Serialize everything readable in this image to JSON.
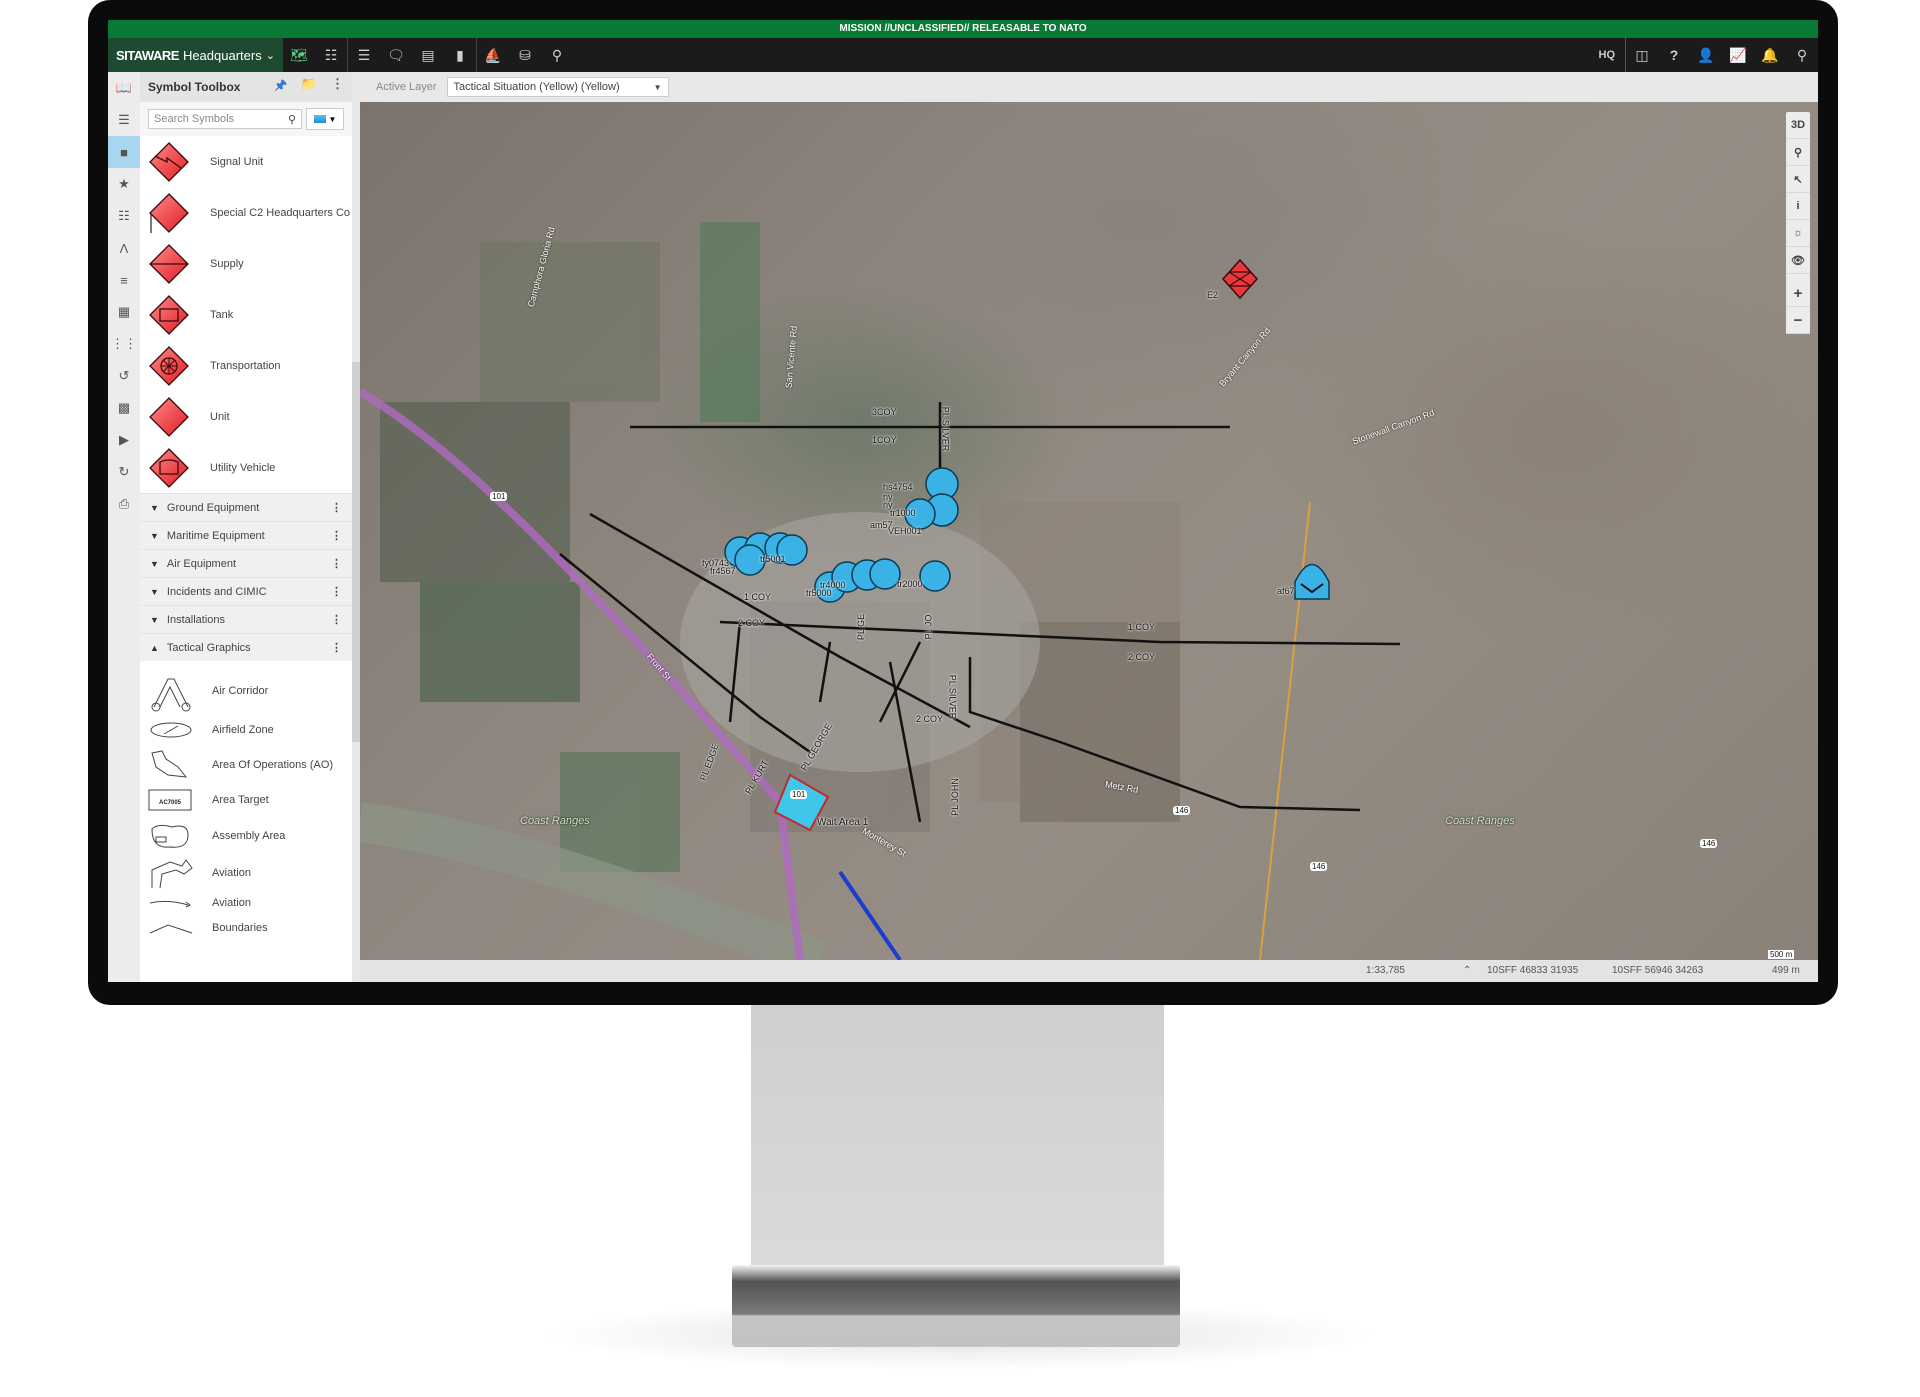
{
  "classification_banner": "MISSION //UNCLASSIFIED// RELEASABLE TO NATO",
  "app": {
    "brand_bold": "SITAWARE",
    "brand_rest": "Headquarters",
    "toolbar_left_icons": [
      "map-icon",
      "hierarchy-icon",
      "layers-list-icon",
      "chat-icon",
      "document-icon",
      "notebook-icon",
      "ship-icon",
      "database-search-icon",
      "search-icon"
    ],
    "hq_label": "HQ",
    "toolbar_right_icons": [
      "split-view-icon",
      "help-icon",
      "user-icon",
      "presentation-icon",
      "bell-icon",
      "search-icon"
    ],
    "colors": {
      "classification_green": "#087a35",
      "brand_bg": "#1e4a30",
      "toolbar_bg": "#1b1b1b",
      "hostile_red": "#e8383d",
      "friendly_blue": "#3ab2e6",
      "bell_yellow": "#e0a800"
    }
  },
  "left_rail": [
    "map-book-icon",
    "layers-icon",
    "symbols-icon",
    "favorites-icon",
    "org-chart-icon",
    "navigation-icon",
    "stack-icon",
    "forms-icon",
    "footsteps-icon",
    "history-icon",
    "film-icon",
    "video-icon",
    "replay-icon",
    "print-icon"
  ],
  "symbol_toolbox": {
    "title": "Symbol Toolbox",
    "search_placeholder": "Search Symbols",
    "units": [
      {
        "label": "Signal Unit",
        "icon": "signal-unit-icon"
      },
      {
        "label": "Special C2 Headquarters Co",
        "icon": "special-c2-hq-icon"
      },
      {
        "label": "Supply",
        "icon": "supply-icon"
      },
      {
        "label": "Tank",
        "icon": "tank-icon"
      },
      {
        "label": "Transportation",
        "icon": "transportation-icon"
      },
      {
        "label": "Unit",
        "icon": "unit-icon"
      },
      {
        "label": "Utility Vehicle",
        "icon": "utility-vehicle-icon"
      }
    ],
    "categories": [
      {
        "label": "Ground Equipment",
        "expanded": false
      },
      {
        "label": "Maritime Equipment",
        "expanded": false
      },
      {
        "label": "Air Equipment",
        "expanded": false
      },
      {
        "label": "Incidents and CIMIC",
        "expanded": false
      },
      {
        "label": "Installations",
        "expanded": false
      },
      {
        "label": "Tactical Graphics",
        "expanded": true
      }
    ],
    "tactical_graphics": [
      {
        "label": "Air Corridor",
        "icon": "air-corridor-icon"
      },
      {
        "label": "Airfield Zone",
        "icon": "airfield-zone-icon"
      },
      {
        "label": "Area Of Operations (AO)",
        "icon": "area-of-operations-icon"
      },
      {
        "label": "Area Target",
        "icon": "area-target-icon",
        "icon_text": "AC7005"
      },
      {
        "label": "Assembly Area",
        "icon": "assembly-area-icon"
      },
      {
        "label": "Aviation",
        "icon": "aviation-arrow-icon"
      },
      {
        "label": "Aviation",
        "icon": "aviation-line-icon"
      },
      {
        "label": "Boundaries",
        "icon": "boundaries-icon"
      }
    ]
  },
  "active_layer": {
    "label": "Active Layer",
    "value": "Tactical Situation (Yellow) (Yellow)"
  },
  "map_tools": [
    "3D",
    "zoom-area-icon",
    "select-icon",
    "info-icon",
    "brightness-icon",
    "visibility-icon",
    "zoom-in-icon",
    "zoom-out-icon"
  ],
  "map": {
    "boundary_labels": [
      "3COY",
      "1COY",
      "1 COY",
      "2 COY",
      "1 COY",
      "2 COY",
      "2 COY"
    ],
    "phase_lines": [
      "PL SILVER",
      "PL SILVER",
      "PL EDGE",
      "PL KURT",
      "PL GEORGE",
      "PL GE",
      "PL JOHN",
      "PL JO"
    ],
    "unit_labels": [
      "hs4754",
      "ny",
      "ny",
      "tr1000",
      "am57",
      "VEH001",
      "ty0743",
      "fr4567",
      "tr5001",
      "tr4000",
      "tr5000",
      "tr2000",
      "af67",
      "E2"
    ],
    "area": "Wait Area 1",
    "place_labels": [
      "Coast Ranges",
      "Coast Ranges"
    ],
    "road_labels": [
      "Front St",
      "Stonewall Canyon Rd",
      "Bryant Canyon Rd",
      "Monterey St",
      "Metz Rd",
      "Camphora Gloria Rd",
      "San Vicente Rd"
    ],
    "shields": [
      "101",
      "101",
      "146",
      "146",
      "146"
    ],
    "scale_bar": "500 m"
  },
  "status_bar": {
    "scale": "1:33,785",
    "coord1": "10SFF 46833 31935",
    "coord2": "10SFF 56946 34263",
    "distance": "499 m"
  }
}
